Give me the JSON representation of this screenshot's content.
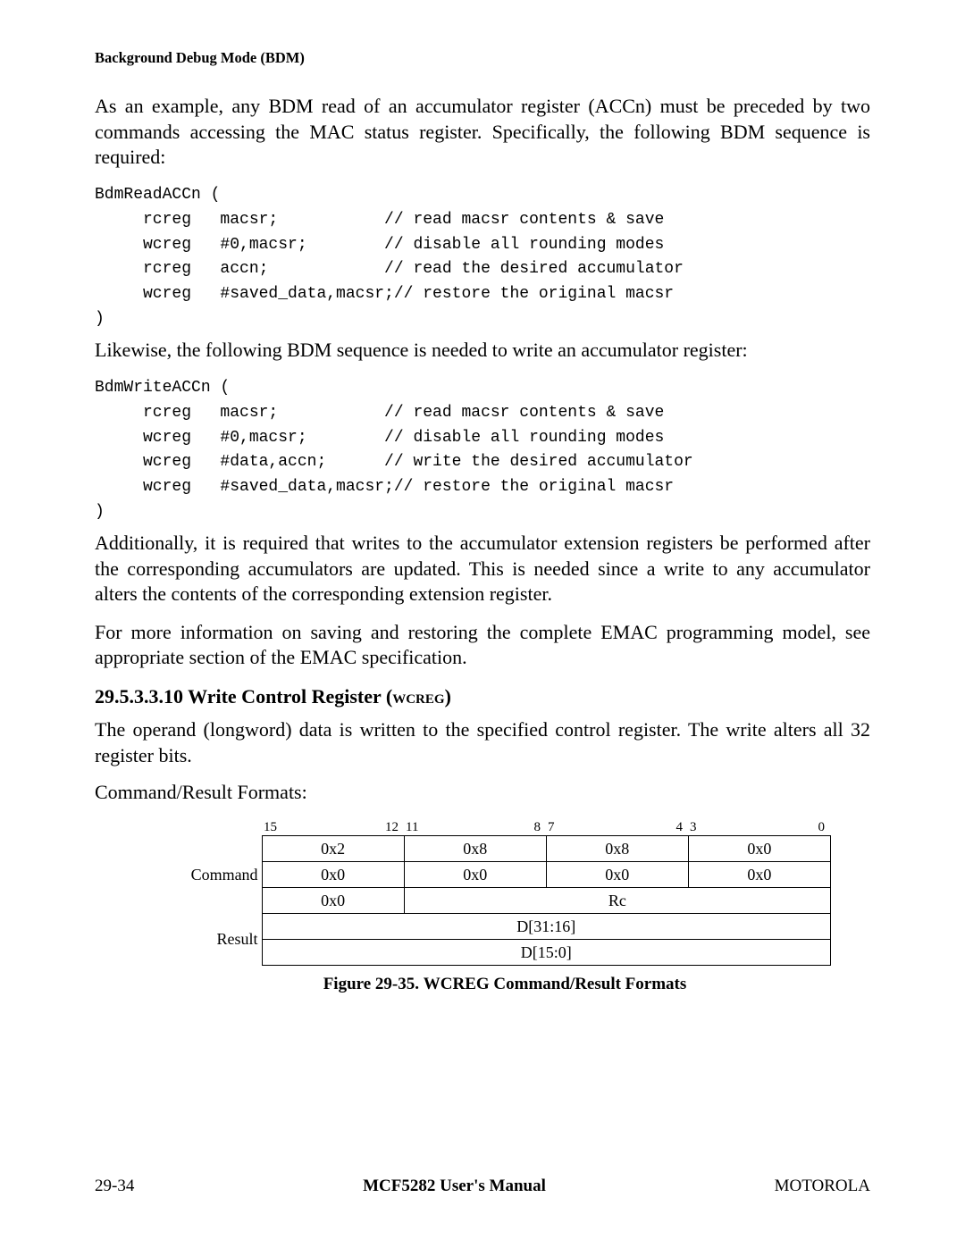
{
  "header": {
    "running_title": "Background Debug Mode (BDM)"
  },
  "paragraphs": {
    "intro": "As an example, any BDM read of an accumulator register (ACCn) must be preceded by two commands accessing the MAC status register. Specifically, the following BDM sequence is required:",
    "likewise": "Likewise, the following BDM sequence is needed to write an accumulator register:",
    "additionally": "Additionally, it is required that writes to the accumulator extension registers be performed after the corresponding accumulators are updated. This is needed since a write to any accumulator alters the contents of the corresponding extension register.",
    "moreinfo": "For more information on saving and restoring the complete EMAC programming model, see appropriate section of the EMAC specification.",
    "wcreg_desc": "The operand (longword) data is written to the specified control register. The write alters all 32 register bits.",
    "formats_label": "Command/Result Formats:"
  },
  "code": {
    "read": "BdmReadACCn (\n     rcreg   macsr;           // read macsr contents & save\n     wcreg   #0,macsr;        // disable all rounding modes\n     rcreg   accn;            // read the desired accumulator\n     wcreg   #saved_data,macsr;// restore the original macsr\n)",
    "write": "BdmWriteACCn (\n     rcreg   macsr;           // read macsr contents & save\n     wcreg   #0,macsr;        // disable all rounding modes\n     wcreg   #data,accn;      // write the desired accumulator\n     wcreg   #saved_data,macsr;// restore the original macsr\n)"
  },
  "section": {
    "number": "29.5.3.3.10  ",
    "title_pre": "Write Control Register (",
    "title_sc": "wcreg",
    "title_post": ")"
  },
  "bitheader": {
    "b15": "15",
    "b12": "12",
    "b11": "11",
    "b8": "8",
    "b7": "7",
    "b4": "4",
    "b3": "3",
    "b0": "0"
  },
  "table": {
    "row_labels": {
      "command": "Command",
      "result": "Result"
    },
    "r1": {
      "c1": "0x2",
      "c2": "0x8",
      "c3": "0x8",
      "c4": "0x0"
    },
    "r2": {
      "c1": "0x0",
      "c2": "0x0",
      "c3": "0x0",
      "c4": "0x0"
    },
    "r3": {
      "c1": "0x0",
      "rc": "Rc"
    },
    "r4": {
      "d": "D[31:16]"
    },
    "r5": {
      "d": "D[15:0]"
    }
  },
  "figure": {
    "number": "Figure 29-35. ",
    "sc": "WCREG",
    "rest": " Command/Result Formats"
  },
  "footer": {
    "left": "29-34",
    "center": "MCF5282 User's Manual",
    "right": "MOTOROLA"
  }
}
